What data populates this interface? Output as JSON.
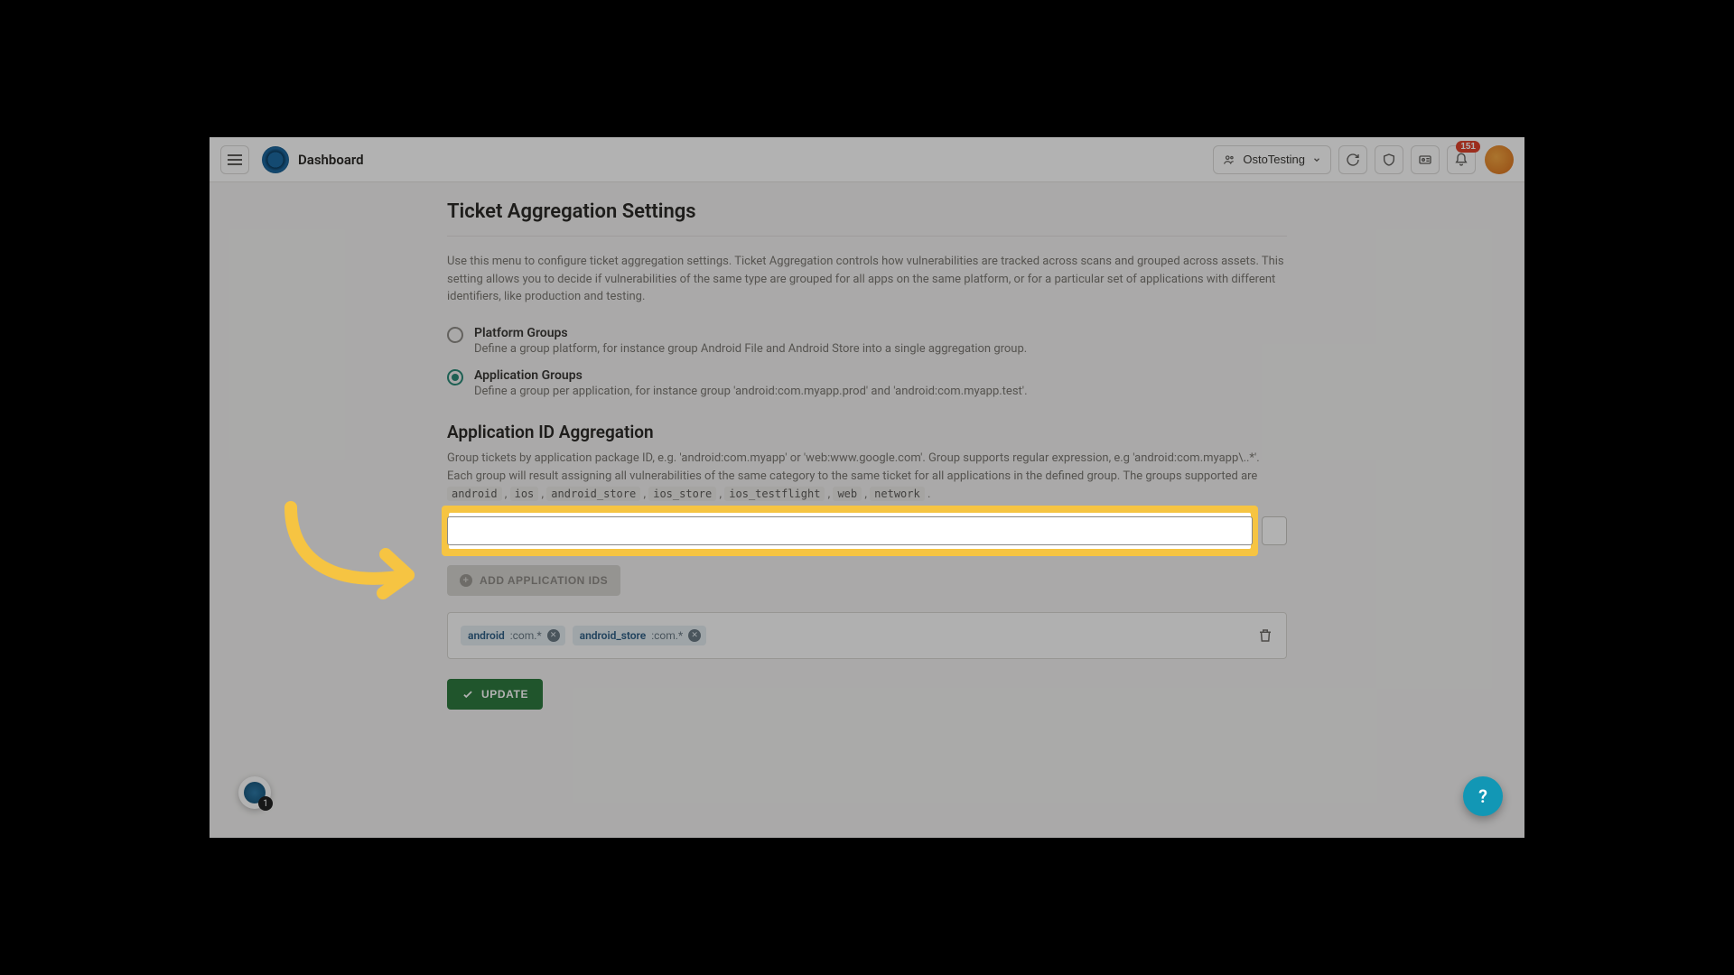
{
  "header": {
    "title": "Dashboard",
    "org_label": "OstoTesting",
    "bell_badge": "151"
  },
  "page": {
    "title": "Ticket Aggregation Settings",
    "intro": "Use this menu to configure ticket aggregation settings. Ticket Aggregation controls how vulnerabilities are tracked across scans and grouped across assets. This setting allows you to decide if vulnerabilities of the same type are grouped for all apps on the same platform, or for a particular set of applications with different identifiers, like production and testing.",
    "options": [
      {
        "label": "Platform Groups",
        "desc": "Define a group platform, for instance group Android File and Android Store into a single aggregation group.",
        "selected": false
      },
      {
        "label": "Application Groups",
        "desc": "Define a group per application, for instance group 'android:com.myapp.prod' and 'android:com.myapp.test'.",
        "selected": true
      }
    ],
    "section_title": "Application ID Aggregation",
    "section_text_a": "Group tickets by application package ID, e.g. 'android:com.myapp' or 'web:www.google.com'. Group supports regular expression, e.g 'android:com.myapp\\..*'. Each group will result assigning all vulnerabilities of the same category to the same ticket for all applications in the defined group. The groups supported are",
    "supported_tags": [
      "android",
      "ios",
      "android_store",
      "ios_store",
      "ios_testflight",
      "web",
      "network"
    ],
    "input_value": "",
    "add_button": "ADD APPLICATION IDS",
    "chips": [
      {
        "prefix": "android",
        "suffix": ":com.*"
      },
      {
        "prefix": "android_store",
        "suffix": ":com.*"
      }
    ],
    "update_button": "UPDATE"
  },
  "widgets": {
    "bl_badge": "1",
    "fab_label": "?"
  }
}
